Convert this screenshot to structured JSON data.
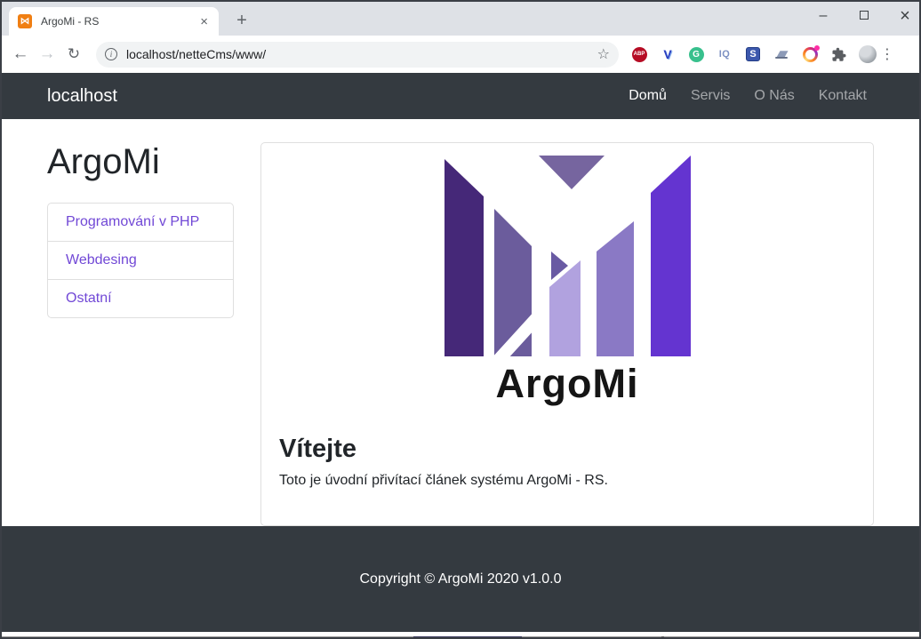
{
  "browser": {
    "tab_title": "ArgoMi - RS",
    "tab_close": "×",
    "new_tab": "+",
    "window_controls": {
      "minimize": "–",
      "close": "×"
    },
    "nav": {
      "back": "←",
      "forward": "→",
      "reload": "↻"
    },
    "omnibox": {
      "info": "i",
      "url": "localhost/netteCms/www/",
      "star": "☆"
    },
    "extensions": {
      "abp": "ABP",
      "v": "V",
      "grammarly": "G",
      "iq": "IQ",
      "s": "S"
    },
    "menu_dots": "⋮",
    "favicon_glyph": "⋈"
  },
  "site": {
    "navbar": {
      "brand": "localhost",
      "links": [
        {
          "label": "Domů",
          "active": true
        },
        {
          "label": "Servis",
          "active": false
        },
        {
          "label": "O Nás",
          "active": false
        },
        {
          "label": "Kontakt",
          "active": false
        }
      ]
    },
    "sidebar": {
      "title": "ArgoMi",
      "items": [
        {
          "label": "Programování v PHP"
        },
        {
          "label": "Webdesing"
        },
        {
          "label": "Ostatní"
        }
      ]
    },
    "article": {
      "logo_caption": "ArgoMi",
      "heading": "Vítejte",
      "text": "Toto je úvodní přivítací článek systému ArgoMi - RS."
    },
    "footer": "Copyright © ArgoMi 2020 v1.0.0"
  },
  "colors": {
    "navbar_bg": "#343a40",
    "link_purple": "#7148d6",
    "logo_palette": [
      "#452878",
      "#6b5c9c",
      "#76659f",
      "#695aa3",
      "#b1a2df",
      "#8a79c5",
      "#6434d0"
    ]
  }
}
